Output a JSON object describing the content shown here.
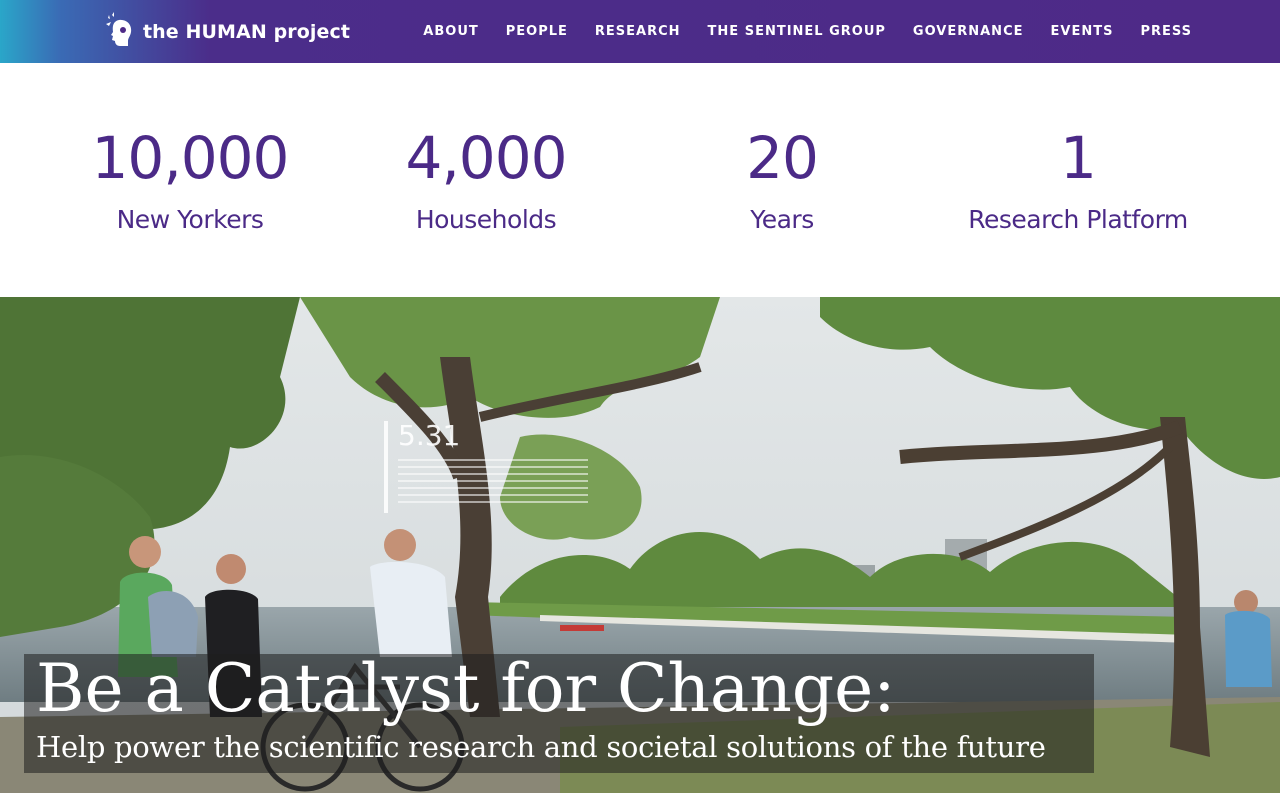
{
  "header": {
    "logo_text": "the HUMAN project",
    "nav": [
      {
        "label": "ABOUT"
      },
      {
        "label": "PEOPLE"
      },
      {
        "label": "RESEARCH"
      },
      {
        "label": "THE SENTINEL GROUP"
      },
      {
        "label": "GOVERNANCE"
      },
      {
        "label": "EVENTS"
      },
      {
        "label": "PRESS"
      }
    ],
    "colors": {
      "brand": "#4e2a87",
      "accent": "#2aa6c9"
    }
  },
  "stats": [
    {
      "value": "10,000",
      "label": "New Yorkers"
    },
    {
      "value": "4,000",
      "label": "Households"
    },
    {
      "value": "20",
      "label": "Years"
    },
    {
      "value": "1",
      "label": "Research Platform"
    }
  ],
  "hero": {
    "title": "Be a Catalyst for Change:",
    "subtitle": "Help power the scientific research and societal solutions of the future",
    "overlay_text": "5.31"
  }
}
